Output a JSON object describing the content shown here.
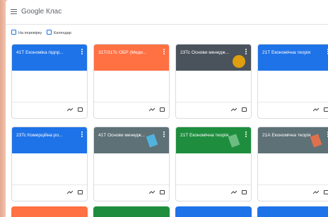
{
  "app": {
    "title": "Google Клас"
  },
  "subbar": {
    "review": "На перевірку",
    "calendar": "Календар"
  },
  "colors": {
    "blue": "#1e73e8",
    "orange": "#ff7043",
    "gray": "#4a535c",
    "green": "#1e8e3e",
    "slate": "#5e7177"
  },
  "cards": [
    {
      "title": "41Т Економіка підпр...",
      "color": "#1e73e8"
    },
    {
      "title": "31Т/31Тс ОБР (Меди...",
      "color": "#ff7043"
    },
    {
      "title": "23Тс Основи менедж...",
      "color": "#4a535c"
    },
    {
      "title": "21Т Економічна теорія",
      "color": "#1e73e8"
    },
    {
      "title": "23Тс Комерційна ро...",
      "color": "#1e73e8"
    },
    {
      "title": "41Т Основи менедж...",
      "color": "#5e7177"
    },
    {
      "title": "21Т Економічна теорія",
      "color": "#1e8e3e"
    },
    {
      "title": "21А Економічна теорія",
      "color": "#5e7177"
    }
  ],
  "bottom_cards": [
    {
      "title": "",
      "color": "#ff7043"
    },
    {
      "title": "...",
      "color": "#1e8e3e"
    },
    {
      "title": "...",
      "color": "#1e73e8"
    },
    {
      "title": "...",
      "color": "#1e73e8"
    }
  ]
}
